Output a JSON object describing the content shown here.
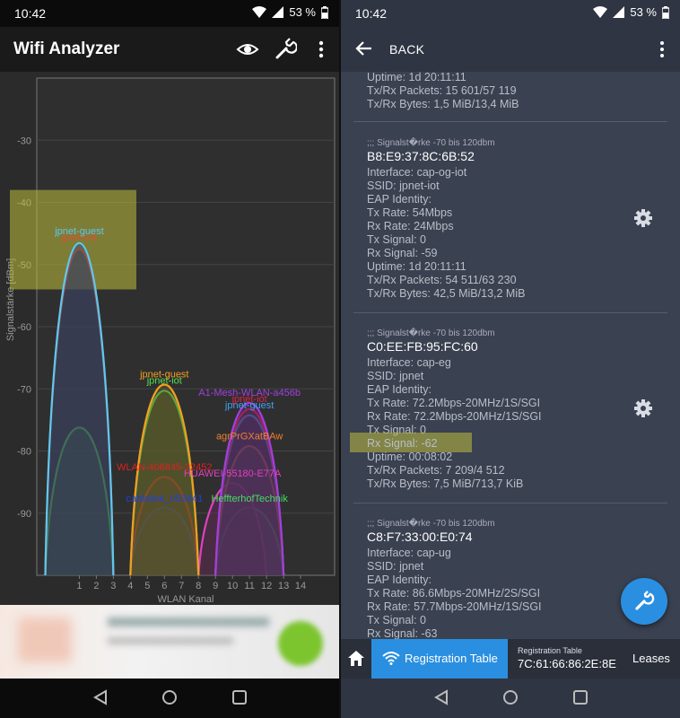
{
  "left": {
    "status": {
      "time": "10:42",
      "battery": "53 %"
    },
    "appbar": {
      "title": "Wifi Analyzer"
    },
    "chart_data": {
      "type": "area",
      "ylabel": "Signalstärke [dBm]",
      "xlabel": "WLAN Kanal",
      "y_ticks": [
        "-30",
        "-40",
        "-50",
        "-60",
        "-70",
        "-80",
        "-90"
      ],
      "y_tick_values": [
        -30,
        -40,
        -50,
        -60,
        -70,
        -80,
        -90
      ],
      "x_ticks": [
        "1",
        "2",
        "3",
        "4",
        "5",
        "6",
        "7",
        "8",
        "9",
        "10",
        "11",
        "12",
        "13",
        "14"
      ],
      "x_tick_values": [
        1,
        2,
        3,
        4,
        5,
        6,
        7,
        8,
        9,
        10,
        11,
        12,
        13,
        14
      ],
      "ylim": [
        -100,
        -20
      ],
      "xlim": [
        -1.5,
        16
      ],
      "grid": true,
      "networks": [
        {
          "label": "jpnet-guest",
          "channel": 1,
          "width": 2,
          "level": -46,
          "color": "#5ec8f0",
          "fill": "#2a4d7a"
        },
        {
          "label": "jpnet-iot",
          "channel": 1,
          "width": 2,
          "level": -47,
          "color": "#e05030",
          "fill": "#5a2a2a"
        },
        {
          "label": "",
          "channel": 1,
          "width": 2,
          "level": -76,
          "color": "#48d848",
          "fill": "#2f6b3a"
        },
        {
          "label": "jpnet-guest",
          "channel": 6,
          "width": 2,
          "level": -69,
          "color": "#f0a020",
          "fill": "#6a5a2a"
        },
        {
          "label": "jpnet-iot",
          "channel": 6,
          "width": 2,
          "level": -70,
          "color": "#50e050",
          "fill": "#4a6a2a"
        },
        {
          "label": "WLAN-406845-22452",
          "channel": 6,
          "width": 2,
          "level": -84,
          "color": "#e02020",
          "fill": "#5a2a2a"
        },
        {
          "label": "cablelink_053441",
          "channel": 6,
          "width": 2,
          "level": -89,
          "color": "#2040e0",
          "fill": "#2a3a6a"
        },
        {
          "label": "A1-Mesh-WLAN-a456b",
          "channel": 11,
          "width": 2,
          "level": -72,
          "color": "#a040e0",
          "fill": "#4a2a6a"
        },
        {
          "label": "jpnet-iot",
          "channel": 11,
          "width": 2,
          "level": -73,
          "color": "#e02050",
          "fill": "#6a2a3a"
        },
        {
          "label": "jpnet-guest",
          "channel": 11,
          "width": 2,
          "level": -74,
          "color": "#40a0f0",
          "fill": "#2a4a7a"
        },
        {
          "label": "agrPrGXatBAw",
          "channel": 11,
          "width": 2,
          "level": -79,
          "color": "#f08030",
          "fill": "#6a4a2a"
        },
        {
          "label": "HUAWEI-55180-E77A",
          "channel": 10,
          "width": 2,
          "level": -85,
          "color": "#e040c0",
          "fill": "#6a2a5a"
        },
        {
          "label": "HeffterhofTechnik",
          "channel": 11,
          "width": 2,
          "level": -89,
          "color": "#40e060",
          "fill": "#2a6a4a"
        }
      ],
      "label_positions_hint": "labels drawn above each curve peak"
    },
    "ad": {
      "text": "Moderne Werbung"
    }
  },
  "right": {
    "status": {
      "time": "10:42",
      "battery": "53 %"
    },
    "appbar": {
      "back_label": "BACK"
    },
    "partial_entry": {
      "lines": [
        "Uptime: 1d 20:11:11",
        "Tx/Rx Packets: 15 601/57 119",
        "Tx/Rx Bytes: 1,5 MiB/13,4 MiB"
      ]
    },
    "entries": [
      {
        "header": ";;; Signalst�rke -70 bis 120dbm",
        "mac": "B8:E9:37:8C:6B:52",
        "lines": [
          "Interface: cap-og-iot",
          "SSID: jpnet-iot",
          "EAP Identity:",
          "Tx Rate: 54Mbps",
          "Rx Rate: 24Mbps",
          "Tx Signal: 0",
          "Rx Signal: -59",
          "Uptime: 1d 20:11:11",
          "Tx/Rx Packets: 54 511/63 230",
          "Tx/Rx Bytes: 42,5 MiB/13,2 MiB"
        ]
      },
      {
        "header": ";;; Signalst�rke -70 bis 120dbm",
        "mac": "C0:EE:FB:95:FC:60",
        "lines": [
          "Interface: cap-eg",
          "SSID: jpnet",
          "EAP Identity:",
          "Tx Rate: 72.2Mbps-20MHz/1S/SGI",
          "Rx Rate: 72.2Mbps-20MHz/1S/SGI",
          "Tx Signal: 0",
          "Rx Signal: -62",
          "Uptime: 00:08:02",
          "Tx/Rx Packets: 7 209/4 512",
          "Tx/Rx Bytes: 7,5 MiB/713,7 KiB"
        ]
      },
      {
        "header": ";;; Signalst�rke -70 bis 120dbm",
        "mac": "C8:F7:33:00:E0:74",
        "lines": [
          "Interface: cap-ug",
          "SSID: jpnet",
          "EAP Identity:",
          "Tx Rate: 86.6Mbps-20MHz/2S/SGI",
          "Rx Rate: 57.7Mbps-20MHz/1S/SGI",
          "Tx Signal: 0",
          "Rx Signal: -63"
        ]
      }
    ],
    "tabs": {
      "registration_table": "Registration Table",
      "info_small": "Registration Table",
      "info_mac": "7C:61:66:86:2E:8E",
      "leases": "Leases"
    }
  }
}
